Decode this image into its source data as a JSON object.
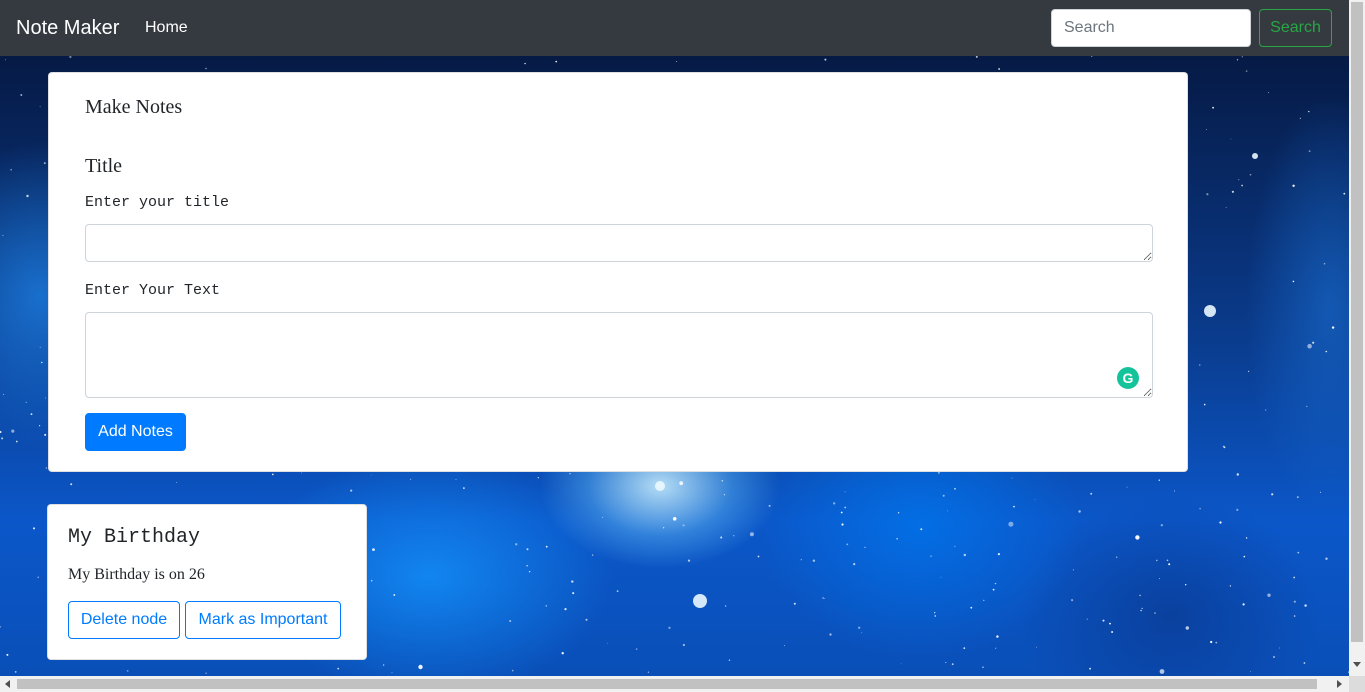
{
  "navbar": {
    "brand": "Note Maker",
    "home_label": "Home",
    "search_placeholder": "Search",
    "search_value": "",
    "search_button_label": "Search"
  },
  "make_notes": {
    "heading": "Make Notes",
    "title_label": "Title",
    "title_field_label": "Enter your title",
    "title_value": "",
    "text_field_label": "Enter Your Text",
    "text_value": "",
    "add_button_label": "Add Notes",
    "grammarly_icon": "grammarly-icon"
  },
  "notes": [
    {
      "title": "My Birthday",
      "text": "My Birthday is on 26",
      "delete_label": "Delete node",
      "important_label": "Mark as Important"
    }
  ],
  "colors": {
    "navbar_bg": "#343a40",
    "primary": "#007bff",
    "success": "#28a745",
    "grammarly": "#15c39a"
  }
}
